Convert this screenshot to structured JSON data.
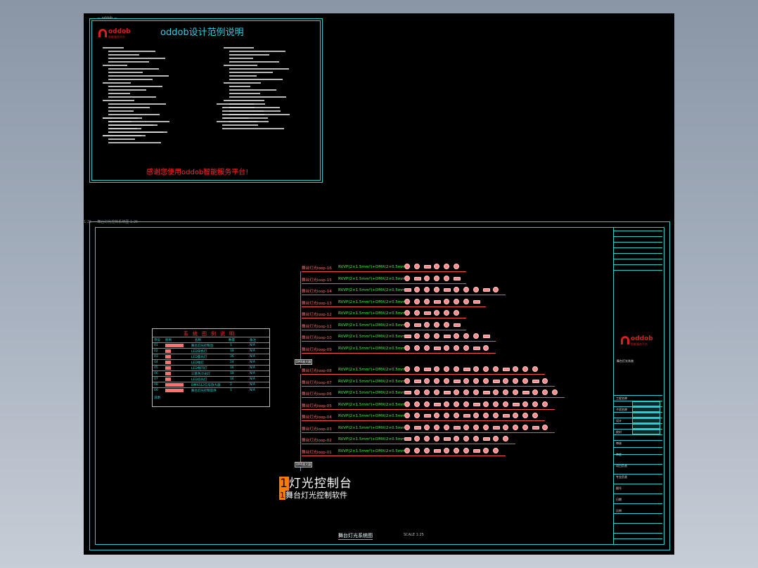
{
  "info_sheet": {
    "tab_label": "—  oddob —",
    "logo_word": "oddob",
    "logo_sub": "智能服务平台",
    "title": "oddob设计范例说明",
    "thanks": "感谢您使用oddob智能服务平台!"
  },
  "dim_label": "1:25   —   舞台灯光控制系统图 1:25",
  "legend": {
    "title": "系统图例说明",
    "headers": [
      "序号",
      "图例",
      "名称",
      "数量",
      "备注"
    ],
    "rows": [
      {
        "no": "01",
        "name": "舞台灯光控制台",
        "qty": "1",
        "note": "N/A"
      },
      {
        "no": "02",
        "name": "LED染色灯",
        "qty": "18",
        "note": "N/A"
      },
      {
        "no": "03",
        "name": "LED面光灯",
        "qty": "36",
        "note": "N/A"
      },
      {
        "no": "04",
        "name": "LED帕灯",
        "qty": "24",
        "note": "N/A"
      },
      {
        "no": "05",
        "name": "LED频闪灯",
        "qty": "16",
        "note": "N/A"
      },
      {
        "no": "06",
        "name": "三基色冷光灯",
        "qty": "18",
        "note": "N/A"
      },
      {
        "no": "07",
        "name": "LED追光灯",
        "qty": "16",
        "note": "N/A"
      },
      {
        "no": "08",
        "name": "DMX512信号放大器",
        "qty": "2",
        "note": "N/A"
      },
      {
        "no": "09",
        "name": "舞台灯光控制软件",
        "qty": "1",
        "note": "N/A"
      }
    ],
    "footnote": "说明"
  },
  "circuits_top": [
    "舞台灯光loop-16",
    "舞台灯光loop-15",
    "舞台灯光loop-14",
    "舞台灯光loop-13",
    "舞台灯光loop-12",
    "舞台灯光loop-11",
    "舞台灯光loop-10",
    "舞台灯光loop-09"
  ],
  "circuits_bottom": [
    "舞台灯光loop-08",
    "舞台灯光loop-07",
    "舞台灯光loop-06",
    "舞台灯光loop-05",
    "舞台灯光loop-04",
    "舞台灯光loop-03",
    "舞台灯光loop-02",
    "舞台灯光loop-01"
  ],
  "cable_spec": "RVVP(2×1.5mm²)+DMX(2×0.5mm)",
  "bus_labels": [
    "DMX放大器",
    "DMX放大器"
  ],
  "controller_big": "灯光控制台",
  "controller_small": "舞台灯光控制软件",
  "drawing_title": "舞台灯光系统图",
  "drawing_scale": "SCALE 1:25",
  "titleblock": {
    "logo_word": "oddob",
    "logo_sub": "智能服务平台",
    "project": "舞台灯光系统",
    "labels": [
      "工程名称",
      "子项名称",
      "设计",
      "校对",
      "审核",
      "审定",
      "项目负责",
      "专业负责",
      "图号",
      "日期",
      "比例"
    ]
  }
}
